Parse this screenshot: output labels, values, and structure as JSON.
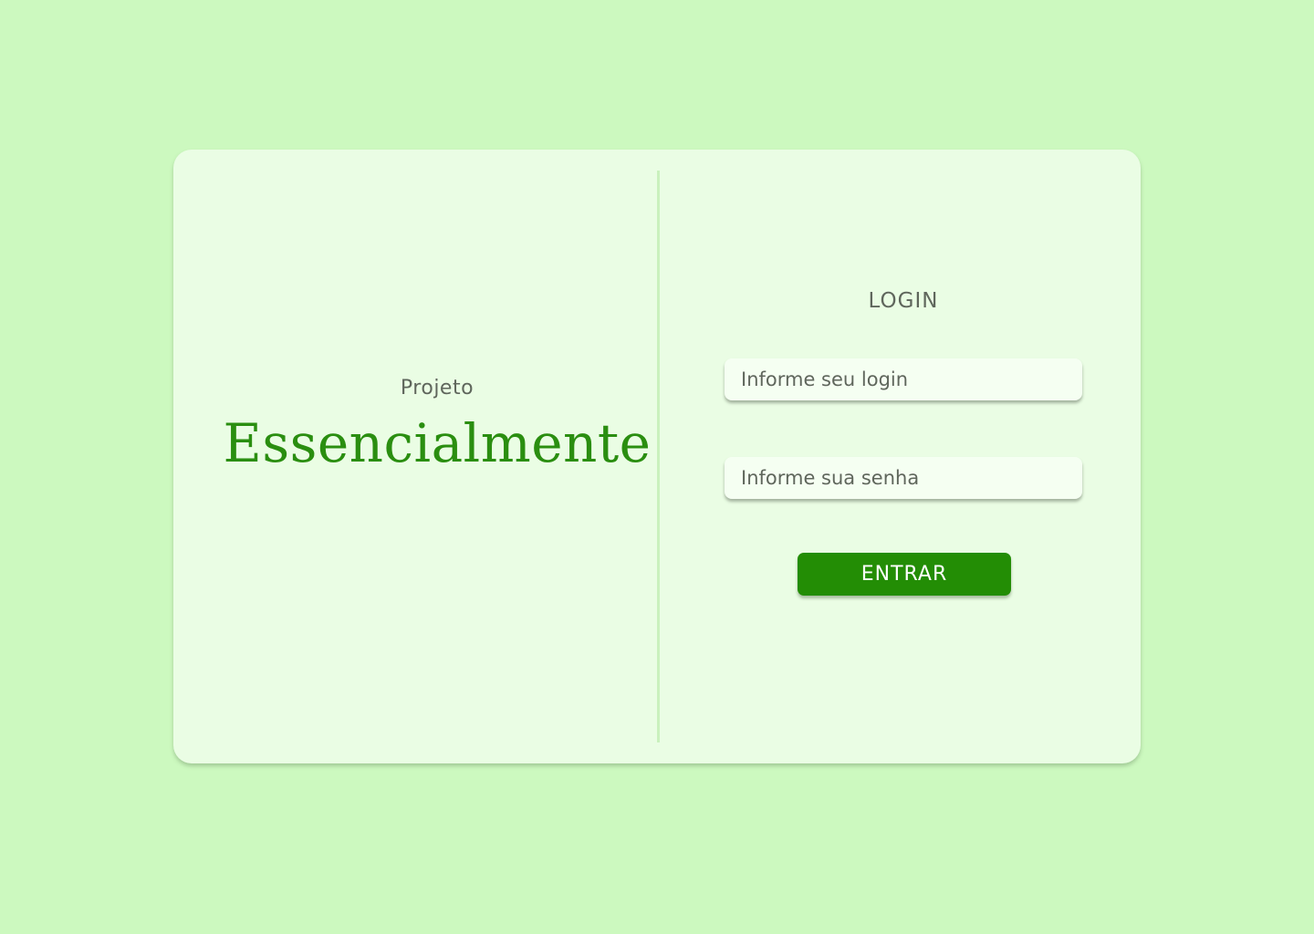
{
  "brand": {
    "kicker": "Projeto",
    "title": "Essencialmente"
  },
  "login": {
    "title": "LOGIN",
    "login_placeholder": "Informe seu login",
    "password_placeholder": "Informe sua senha",
    "submit_label": "ENTRAR"
  },
  "colors": {
    "background": "#ccf9bf",
    "card": "#eafde4",
    "accent": "#238d05",
    "brand_text": "#2a8e10",
    "muted_text": "#5f665c"
  }
}
